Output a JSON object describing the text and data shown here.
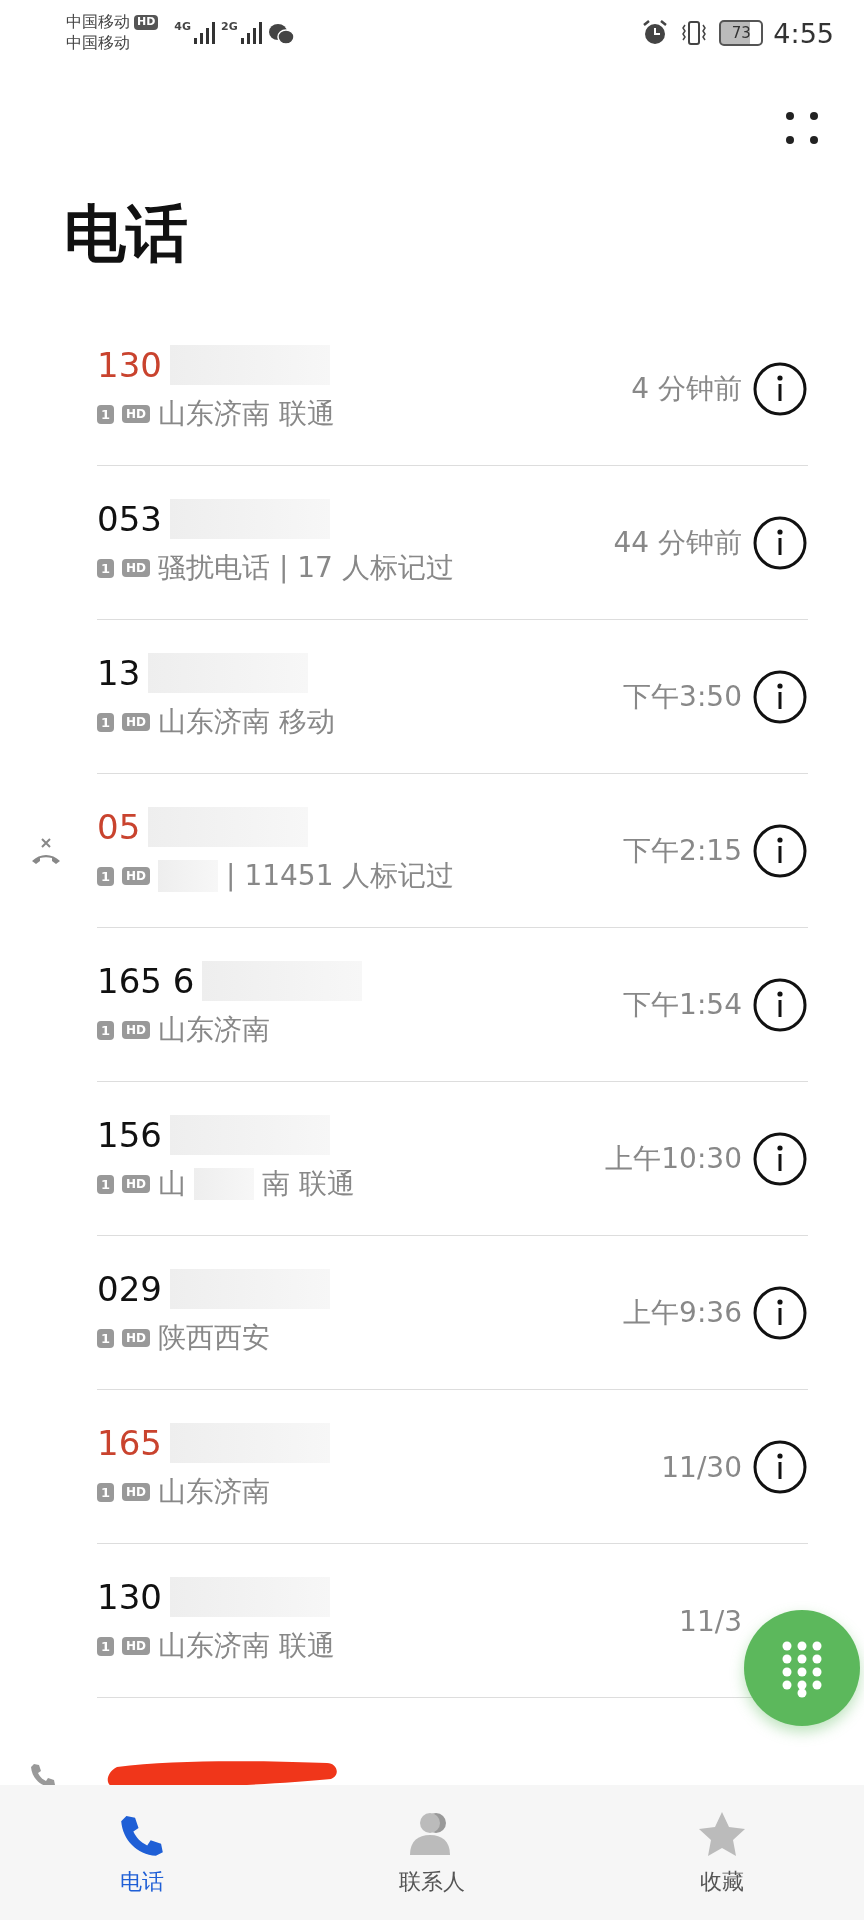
{
  "status_bar": {
    "carrier_1": "中国移动",
    "hd": "HD",
    "carrier_2": "中国移动",
    "network_1": "4G",
    "network_2": "2G",
    "battery": "73",
    "time": "4:55"
  },
  "title": "电话",
  "calls": [
    {
      "kind": "call",
      "number": "130",
      "missed": true,
      "blocked": false,
      "sim": "1",
      "hd": "HD",
      "detail": "山东济南 联通",
      "time": "4 分钟前"
    },
    {
      "kind": "call",
      "number": "053",
      "missed": false,
      "blocked": false,
      "sim": "1",
      "hd": "HD",
      "detail": "骚扰电话 | 17 人标记过",
      "time": "44 分钟前"
    },
    {
      "kind": "call",
      "number": "13",
      "missed": false,
      "blocked": false,
      "sim": "1",
      "hd": "HD",
      "detail": "山东济南 移动",
      "time": "下午3:50"
    },
    {
      "kind": "call",
      "number": "05",
      "missed": true,
      "blocked": true,
      "sim": "1",
      "hd": "HD",
      "detail_masked": true,
      "detail": "| 11451 人标记过",
      "time": "下午2:15"
    },
    {
      "kind": "call",
      "number": "165 6",
      "missed": false,
      "blocked": false,
      "sim": "1",
      "hd": "HD",
      "detail": "山东济南",
      "time": "下午1:54"
    },
    {
      "kind": "call",
      "number": "156",
      "missed": false,
      "blocked": false,
      "sim": "1",
      "hd": "HD",
      "detail_before": "山",
      "detail_masked": true,
      "detail": "南 联通",
      "time": "上午10:30"
    },
    {
      "kind": "call",
      "number": "029",
      "missed": false,
      "blocked": false,
      "sim": "1",
      "hd": "HD",
      "detail": "陕西西安",
      "time": "上午9:36"
    },
    {
      "kind": "call",
      "number": "165",
      "missed": true,
      "blocked": false,
      "sim": "1",
      "hd": "HD",
      "detail": "山东济南",
      "time": "11/30"
    },
    {
      "kind": "call",
      "number": "130",
      "missed": false,
      "blocked": false,
      "sim": "1",
      "hd": "HD",
      "detail": "山东济南 联通",
      "time": "11/3"
    },
    {
      "kind": "scribbled"
    }
  ],
  "nav": [
    {
      "label": "电话",
      "selected": true
    },
    {
      "label": "联系人",
      "selected": false
    },
    {
      "label": "收藏",
      "selected": false
    }
  ]
}
